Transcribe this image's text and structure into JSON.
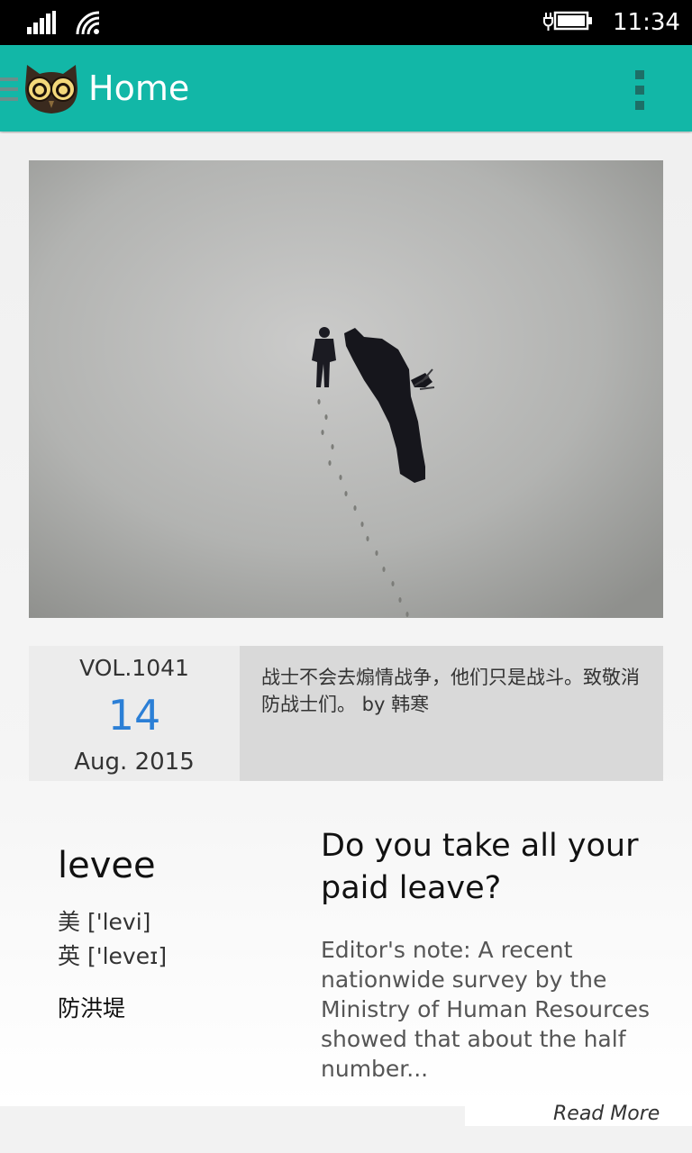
{
  "status_bar": {
    "time": "11:34"
  },
  "app_bar": {
    "title": "Home"
  },
  "card": {
    "vol": "VOL.1041",
    "day": "14",
    "month_year": "Aug. 2015",
    "quote": "战士不会去煽情战争，他们只是战斗。致敬消防战士们。 by 韩寒",
    "word": {
      "term": "levee",
      "us_pron": "美 ['levi]",
      "uk_pron": "英 ['leveɪ]",
      "meaning": "防洪堤"
    },
    "article": {
      "title": "Do you take all your paid leave?",
      "excerpt": "Editor's note: A recent nationwide survey by the Ministry of Human Resources showed that about the half number...",
      "read_more": "Read More"
    }
  },
  "colors": {
    "accent": "#12b7a7",
    "day_number": "#2b7fd6"
  },
  "icons": [
    "signal-icon",
    "wifi-icon",
    "battery-icon",
    "hamburger-menu-icon",
    "owl-logo-icon",
    "more-vertical-icon"
  ]
}
